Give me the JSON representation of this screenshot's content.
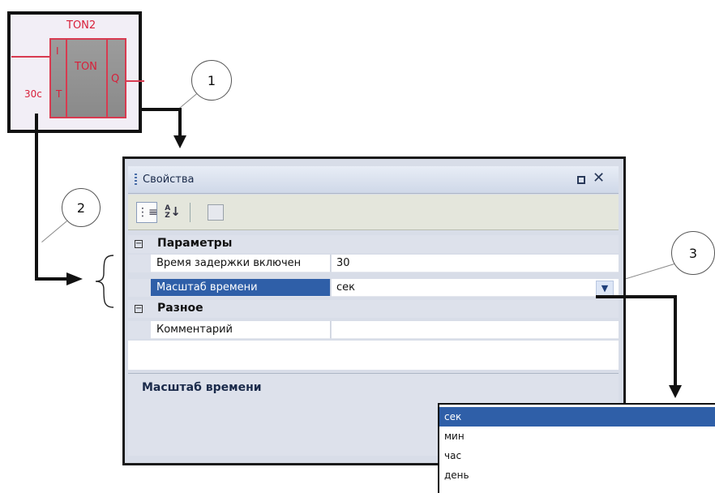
{
  "ton_block": {
    "instance_name": "TON2",
    "type_label": "TON",
    "input_in": "I",
    "input_t": "T",
    "output_q": "Q",
    "preset_value": "30c"
  },
  "callouts": [
    "1",
    "2",
    "3"
  ],
  "window": {
    "title": "Свойства"
  },
  "toolbar": {
    "categorized_icon": "categorized-icon",
    "alphabetical_label": "A↓Z",
    "property_pages_icon": "property-pages-icon"
  },
  "grid": {
    "categories": [
      {
        "label": "Параметры",
        "expander": "⊟",
        "properties": [
          {
            "name": "Время задержки включен",
            "value": "30"
          },
          {
            "name": "Масштаб времени",
            "value": "сек"
          }
        ]
      },
      {
        "label": "Разное",
        "expander": "⊟",
        "properties": [
          {
            "name": "Комментарий",
            "value": ""
          }
        ]
      }
    ]
  },
  "description": {
    "title": "Масштаб времени"
  },
  "dropdown": {
    "selected": "сек",
    "options": [
      "сек",
      "мин",
      "час",
      "день"
    ]
  },
  "colors": {
    "selection": "#2f5fa8",
    "ton_accent": "#d8203a"
  }
}
